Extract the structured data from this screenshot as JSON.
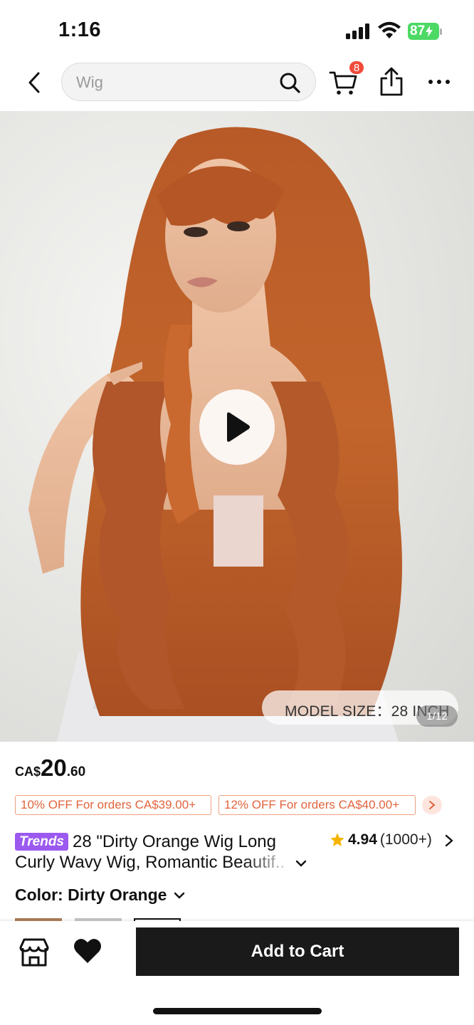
{
  "status_bar": {
    "time": "1:16",
    "battery": "87"
  },
  "nav": {
    "search_placeholder": "Wig",
    "cart_badge_count": "8",
    "icons": [
      "back-chevron-icon",
      "search-icon",
      "cart-icon",
      "share-icon",
      "more-icon"
    ]
  },
  "hero": {
    "model_size": "MODEL SIZE：28 INCH",
    "image_counter": "1/12",
    "hair_color": "#c0612a",
    "background_color": "#e2e2df"
  },
  "price": {
    "currency": "CA$",
    "main": "20",
    "cents": ".60"
  },
  "coupons": [
    {
      "label": "10% OFF For orders CA$39.00+"
    },
    {
      "label": "12% OFF For orders CA$40.00+"
    }
  ],
  "product": {
    "badge": "Trends",
    "title_line1": "28 \"Dirty Orange Wig Long",
    "title_line2": "Curly Wavy Wig, Romantic Beautif..",
    "rating_score": "4.94",
    "rating_count": "(1000+)"
  },
  "color": {
    "label": "Color: Dirty Orange"
  },
  "bottom_bar": {
    "add_to_cart": "Add to Cart"
  },
  "colors": {
    "accent_coupon": "#e0643e",
    "badge_red": "#f04b3a",
    "trends_purple": "#9b59f0",
    "star_yellow": "#f5b400",
    "cta_black": "#1a1a1a"
  }
}
